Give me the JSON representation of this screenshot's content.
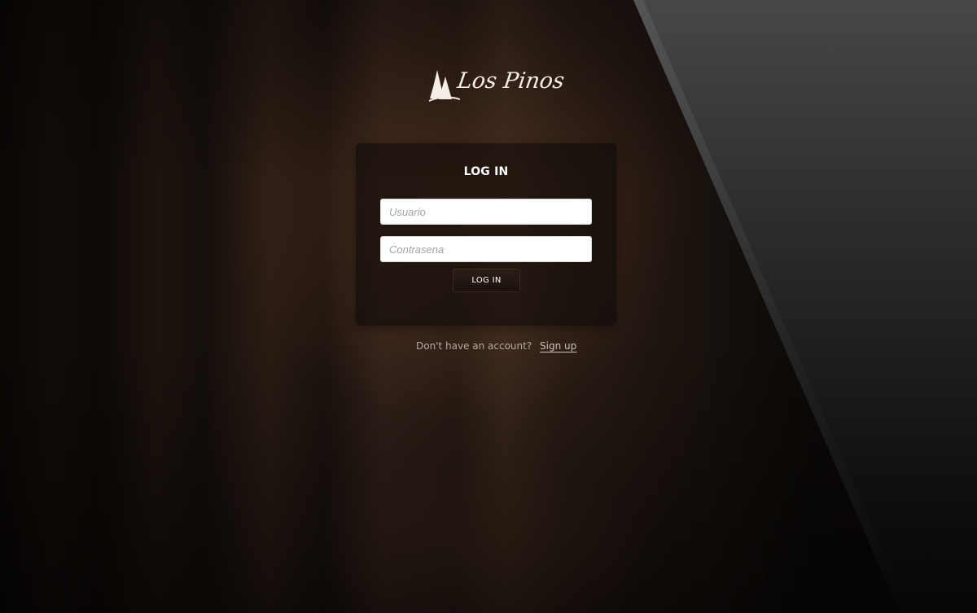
{
  "brand": {
    "logo_text": "Los Pinos"
  },
  "login": {
    "title": "LOG IN",
    "username_placeholder": "Usuario",
    "password_placeholder": "Contrasena",
    "button_label": "LOG IN"
  },
  "signup": {
    "prompt": "Don't have an account?",
    "link_label": "Sign up"
  },
  "colors": {
    "accent_button": "#1f150f",
    "text_primary": "#ffffff",
    "text_muted": "#b3aaa3"
  },
  "icons": {
    "logo_mark": "pine-trees-icon"
  }
}
